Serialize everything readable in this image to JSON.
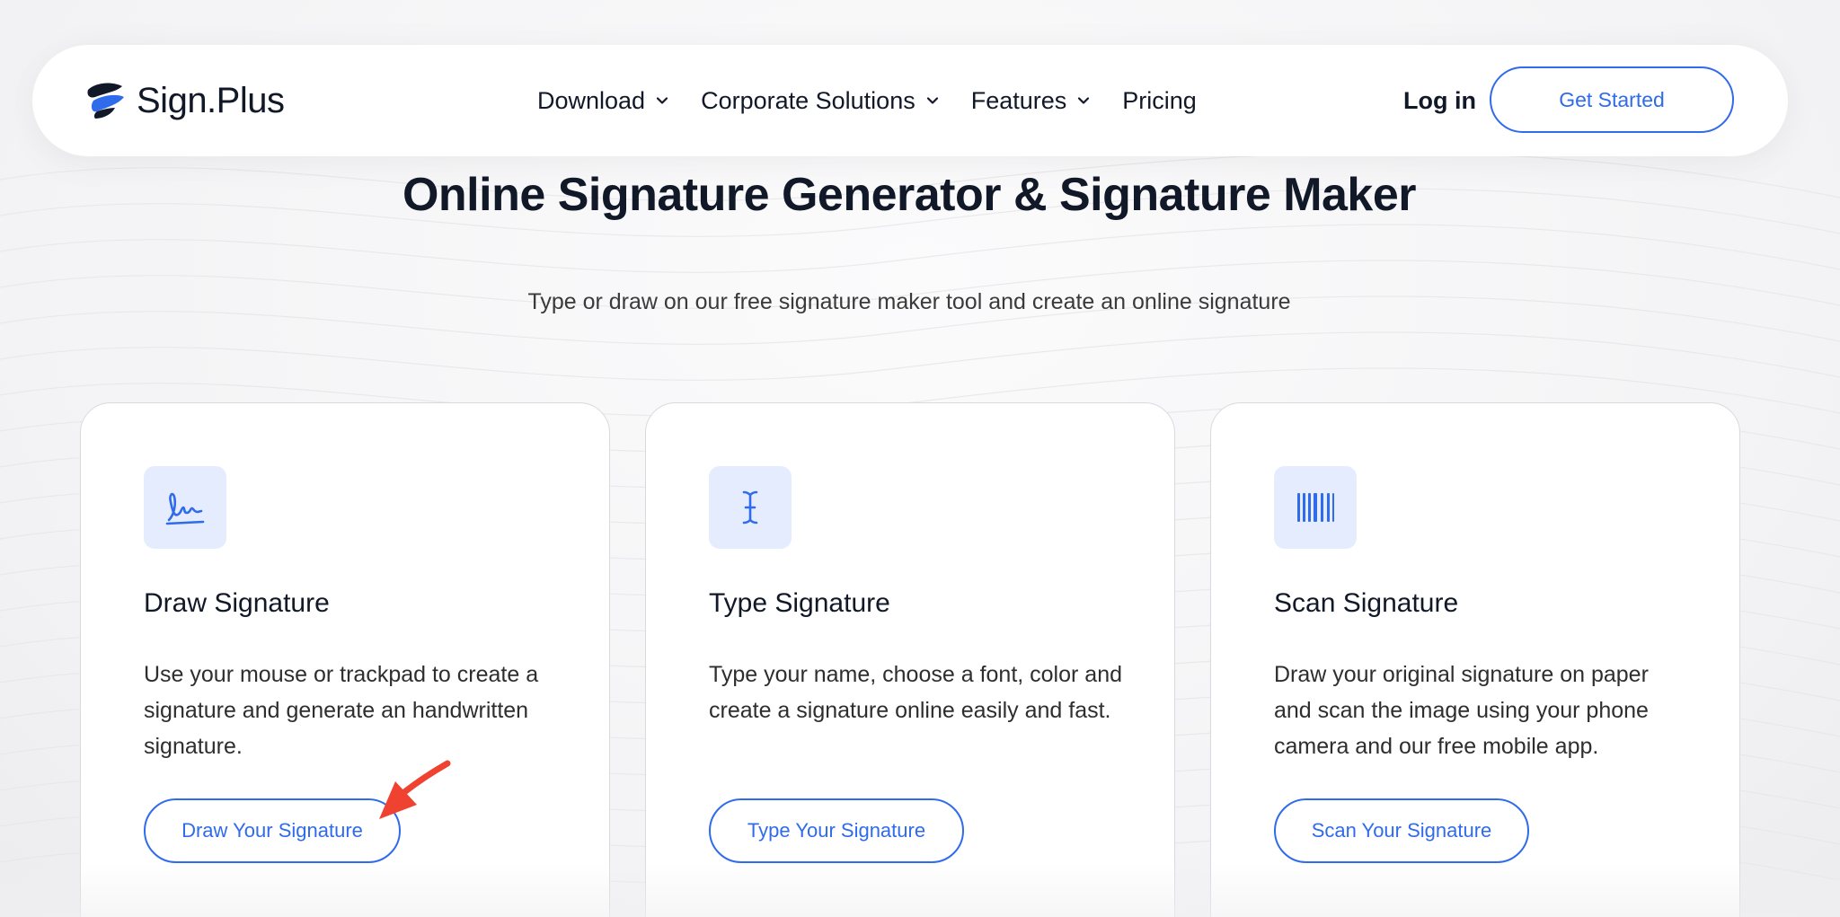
{
  "header": {
    "logo_text": "Sign.Plus",
    "nav": [
      {
        "label": "Download",
        "has_dropdown": true
      },
      {
        "label": "Corporate Solutions",
        "has_dropdown": true
      },
      {
        "label": "Features",
        "has_dropdown": true
      },
      {
        "label": "Pricing",
        "has_dropdown": false
      }
    ],
    "login_label": "Log in",
    "get_started_label": "Get Started"
  },
  "hero": {
    "title": "Online Signature Generator & Signature Maker",
    "subtitle": "Type or draw on our free signature maker tool and create an online signature"
  },
  "cards": [
    {
      "icon": "signature-icon",
      "title": "Draw Signature",
      "description": "Use your mouse or trackpad to create a signature and generate an handwritten signature.",
      "button": "Draw Your Signature"
    },
    {
      "icon": "text-cursor-icon",
      "title": "Type Signature",
      "description": "Type your name, choose a font, color and create a signature online easily and fast.",
      "button": "Type Your Signature"
    },
    {
      "icon": "barcode-scan-icon",
      "title": "Scan Signature",
      "description": "Draw your original signature on paper and scan the image using your phone camera and our free mobile app.",
      "button": "Scan Your Signature"
    }
  ],
  "colors": {
    "accent": "#2f6bea",
    "icon_bg": "#e5ecfd",
    "annotation_arrow": "#ef4230"
  }
}
